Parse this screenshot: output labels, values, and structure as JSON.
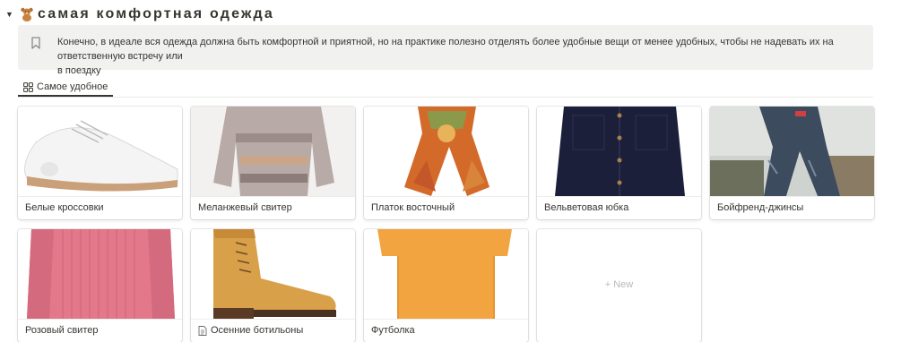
{
  "section": {
    "title": "самая комфортная одежда",
    "toggle_icon": "triangle-down-icon",
    "emoji_icon": "teddy-bear-icon"
  },
  "callout": {
    "icon": "bookmark-icon",
    "text_line1": "Конечно, в идеале вся одежда должна быть комфортной и приятной, но на практике полезно отделять более удобные вещи от менее удобных, чтобы не надевать их на ответственную встречу или",
    "text_line2": "в поездку"
  },
  "view_tab": {
    "icon": "gallery-grid-icon",
    "label": "Самое удобное"
  },
  "cards": [
    {
      "title": "Белые кроссовки",
      "image": "white-sneakers"
    },
    {
      "title": "Меланжевый свитер",
      "image": "melange-sweater"
    },
    {
      "title": "Платок восточный",
      "image": "oriental-scarf"
    },
    {
      "title": "Вельветовая юбка",
      "image": "corduroy-skirt"
    },
    {
      "title": "Бойфренд-джинсы",
      "image": "boyfriend-jeans"
    },
    {
      "title": "Розовый свитер",
      "image": "pink-sweater"
    },
    {
      "title": "Осенние ботильоны",
      "image": "autumn-boots",
      "page_icon": "document-icon"
    },
    {
      "title": "Футболка",
      "image": "orange-tshirt"
    }
  ],
  "new_card": {
    "label": "+ New"
  },
  "colors": {
    "callout_bg": "#f1f1ef",
    "text": "#37352f",
    "muted": "#b9b9b6"
  }
}
